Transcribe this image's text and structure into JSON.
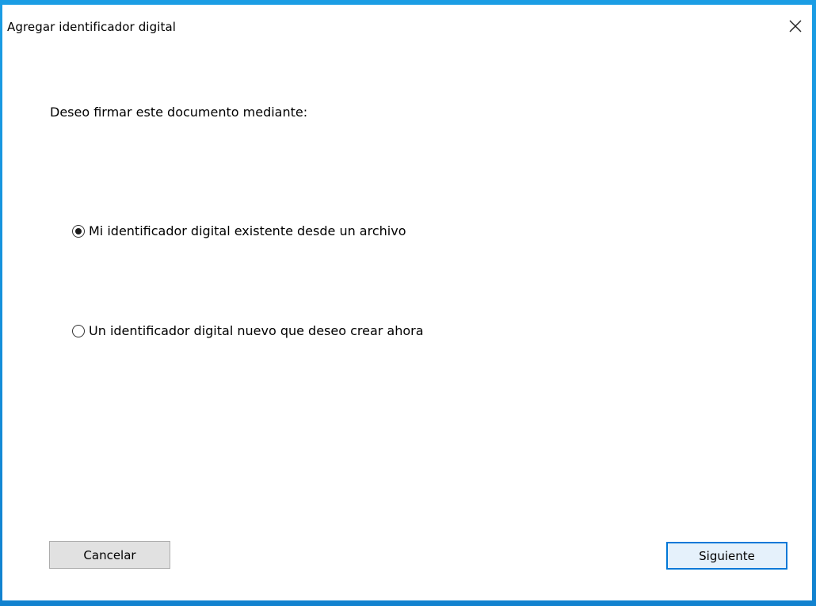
{
  "window": {
    "title": "Agregar identificador digital",
    "close_icon": "close-icon"
  },
  "body": {
    "prompt": "Deseo firmar este documento mediante:",
    "options": [
      {
        "label": "Mi identificador digital existente desde un archivo",
        "selected": true
      },
      {
        "label": "Un identificador digital nuevo que deseo crear ahora",
        "selected": false
      }
    ]
  },
  "buttons": {
    "cancel_label": "Cancelar",
    "next_label": "Siguiente"
  },
  "colors": {
    "desktop_accent": "#1591dc",
    "default_button_border": "#0078d7",
    "default_button_fill": "#e5f1fb",
    "button_fill": "#e1e1e1"
  }
}
